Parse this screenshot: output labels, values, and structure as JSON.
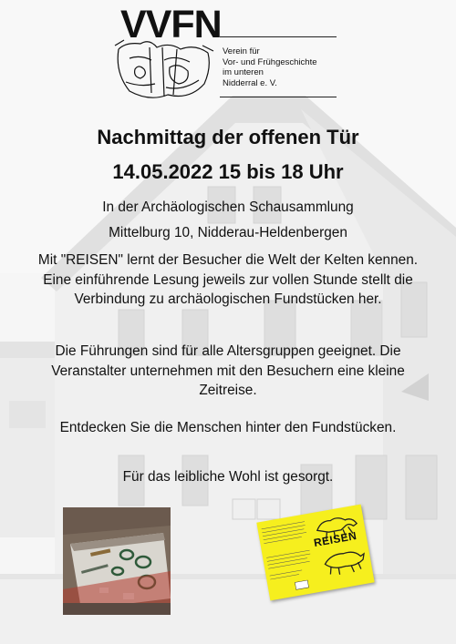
{
  "logo": {
    "wordmark": "VVFN",
    "org_lines": [
      "Verein für",
      "Vor- und Frühgeschichte",
      "im unteren",
      "Nidderral e. V."
    ]
  },
  "headline": {
    "line1": "Nachmittag der offenen Tür",
    "line2": "14.05.2022 15 bis 18 Uhr"
  },
  "body": {
    "location1": "In der Archäologischen Schausammlung",
    "location2": "Mittelburg 10, Nidderau-Heldenbergen",
    "paragraph1": "Mit \"REISEN\" lernt der Besucher die Welt der Kelten kennen. Eine einführende Lesung jeweils zur vollen Stunde stellt die Verbindung zu archäologischen Fundstücken her.",
    "paragraph2": "Die Führungen sind für alle Altersgruppen geeignet. Die Veranstalter unternehmen mit den Besuchern eine kleine Zeitreise.",
    "paragraph3": "Entdecken Sie die Menschen hinter den Fundstücken.",
    "paragraph4": "Für das leibliche Wohl ist gesorgt."
  },
  "book": {
    "title": "REISEN"
  },
  "colors": {
    "book_yellow": "#f6ef1e",
    "text": "#111111"
  }
}
